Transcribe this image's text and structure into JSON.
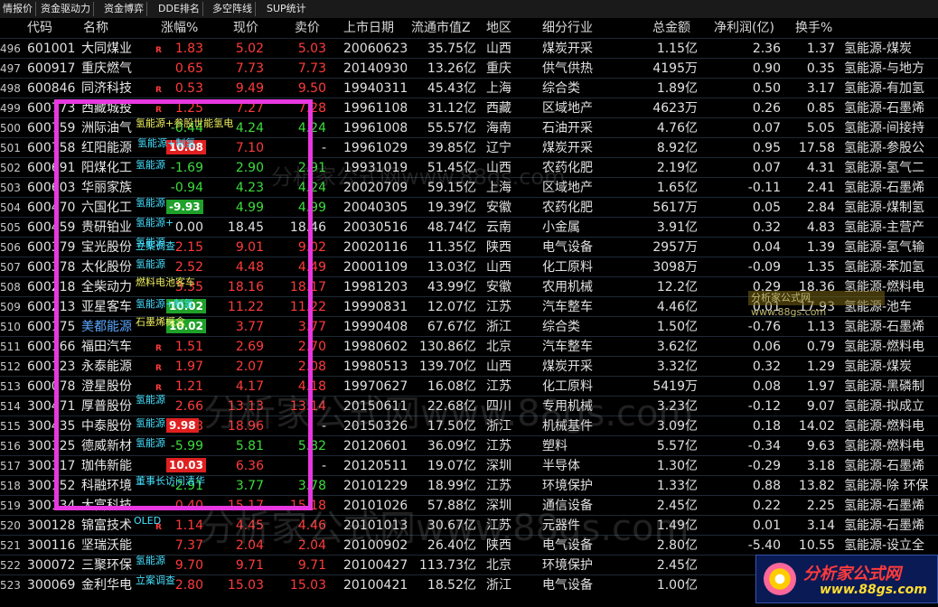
{
  "tabs": [
    "情报价",
    "资金驱动力",
    "资金博弈",
    "DDE排名",
    "多空阵线",
    "SUP统计"
  ],
  "columns": [
    "代码",
    "名称",
    "涨幅%",
    "现价",
    "卖价",
    "上市日期",
    "流通市值Z",
    "地区",
    "细分行业",
    "总金额",
    "净利润(亿)",
    "换手%"
  ],
  "colors": {
    "up": "#ff3b3b",
    "down": "#3cdc3c",
    "accent": "#e838e0"
  },
  "rows": [
    {
      "no": "496",
      "code": "601001",
      "name": "大同煤业",
      "chg": "1.83",
      "price": "5.02",
      "ask": "5.03",
      "date": "20060623",
      "mcap": "35.75亿",
      "region": "山西",
      "industry": "煤炭开采",
      "amount": "1.15亿",
      "profit": "2.36",
      "turnover": "1.37",
      "concept": "氢能源-煤炭",
      "dir": "up",
      "r": true
    },
    {
      "no": "497",
      "code": "600917",
      "name": "重庆燃气",
      "chg": "0.65",
      "price": "7.73",
      "ask": "7.73",
      "date": "20140930",
      "mcap": "13.26亿",
      "region": "重庆",
      "industry": "供气供热",
      "amount": "4195万",
      "profit": "0.90",
      "turnover": "0.35",
      "concept": "氢能源-与地方",
      "dir": "up",
      "r": false
    },
    {
      "no": "498",
      "code": "600846",
      "name": "同济科技",
      "chg": "0.53",
      "price": "9.49",
      "ask": "9.50",
      "date": "19940311",
      "mcap": "45.43亿",
      "region": "上海",
      "industry": "综合类",
      "amount": "1.89亿",
      "profit": "0.50",
      "turnover": "3.17",
      "concept": "氢能源-有加氢",
      "dir": "up",
      "r": true
    },
    {
      "no": "499",
      "code": "600773",
      "name": "西藏城投",
      "chg": "1.25",
      "price": "7.27",
      "ask": "7.28",
      "date": "19961108",
      "mcap": "31.12亿",
      "region": "西藏",
      "industry": "区域地产",
      "amount": "4623万",
      "profit": "0.26",
      "turnover": "0.85",
      "concept": "氢能源-石墨烯",
      "dir": "up",
      "r": true
    },
    {
      "no": "500",
      "code": "600759",
      "name": "洲际油气",
      "chg": "-0.44",
      "price": "4.24",
      "ask": "4.24",
      "date": "19961008",
      "mcap": "55.57亿",
      "region": "海南",
      "industry": "石油开采",
      "amount": "4.76亿",
      "profit": "0.07",
      "turnover": "5.05",
      "concept": "氢能源-间接持",
      "dir": "down",
      "r": false
    },
    {
      "no": "501",
      "code": "600758",
      "name": "红阳能源",
      "chg": "10.08",
      "price": "7.10",
      "ask": "-",
      "date": "19961029",
      "mcap": "39.85亿",
      "region": "辽宁",
      "industry": "煤炭开采",
      "amount": "8.92亿",
      "profit": "0.95",
      "turnover": "17.58",
      "concept": "氢能源-参股公",
      "dir": "up",
      "r": false
    },
    {
      "no": "502",
      "code": "600691",
      "name": "阳煤化工",
      "chg": "-1.69",
      "price": "2.90",
      "ask": "2.91",
      "date": "19931019",
      "mcap": "51.45亿",
      "region": "山西",
      "industry": "农药化肥",
      "amount": "2.19亿",
      "profit": "0.07",
      "turnover": "4.31",
      "concept": "氢能源-氢气二",
      "dir": "down",
      "r": false
    },
    {
      "no": "503",
      "code": "600603",
      "name": "华丽家族",
      "chg": "-0.94",
      "price": "4.23",
      "ask": "4.24",
      "date": "20020709",
      "mcap": "59.15亿",
      "region": "上海",
      "industry": "区域地产",
      "amount": "1.65亿",
      "profit": "-0.11",
      "turnover": "2.41",
      "concept": "氢能源-石墨烯",
      "dir": "down",
      "r": false
    },
    {
      "no": "504",
      "code": "600470",
      "name": "六国化工",
      "chg": "-9.93",
      "price": "4.99",
      "ask": "4.99",
      "date": "20040305",
      "mcap": "19.39亿",
      "region": "安徽",
      "industry": "农药化肥",
      "amount": "5617万",
      "profit": "0.05",
      "turnover": "2.84",
      "concept": "氢能源-煤制氢",
      "dir": "down",
      "r": false
    },
    {
      "no": "505",
      "code": "600459",
      "name": "贵研铂业",
      "chg": "0.00",
      "price": "18.45",
      "ask": "18.46",
      "date": "20030516",
      "mcap": "48.74亿",
      "region": "云南",
      "industry": "小金属",
      "amount": "3.91亿",
      "profit": "0.32",
      "turnover": "4.83",
      "concept": "氢能源-主营产",
      "dir": "flat",
      "r": false
    },
    {
      "no": "506",
      "code": "600379",
      "name": "宝光股份",
      "chg": "2.15",
      "price": "9.01",
      "ask": "9.02",
      "date": "20020116",
      "mcap": "11.35亿",
      "region": "陕西",
      "industry": "电气设备",
      "amount": "2957万",
      "profit": "0.04",
      "turnover": "1.39",
      "concept": "氢能源-氢气输",
      "dir": "up",
      "r": false
    },
    {
      "no": "507",
      "code": "600378",
      "name": "太化股份",
      "chg": "2.52",
      "price": "4.48",
      "ask": "4.49",
      "date": "20001109",
      "mcap": "13.03亿",
      "region": "山西",
      "industry": "化工原料",
      "amount": "3098万",
      "profit": "-0.09",
      "turnover": "1.35",
      "concept": "氢能源-苯加氢",
      "dir": "up",
      "r": false
    },
    {
      "no": "508",
      "code": "600218",
      "name": "全柴动力",
      "chg": "3.35",
      "price": "18.16",
      "ask": "18.17",
      "date": "19981203",
      "mcap": "43.99亿",
      "region": "安徽",
      "industry": "农用机械",
      "amount": "12.2亿",
      "profit": "0.29",
      "turnover": "18.36",
      "concept": "氢能源-燃料电",
      "dir": "up",
      "r": false
    },
    {
      "no": "509",
      "code": "600213",
      "name": "亚星客车",
      "chg": "10.02",
      "price": "11.22",
      "ask": "11.22",
      "date": "19990831",
      "mcap": "12.07亿",
      "region": "江苏",
      "industry": "汽车整车",
      "amount": "4.46亿",
      "profit": "0.01",
      "turnover": "17.93",
      "concept": "氢能源-池车",
      "dir": "up",
      "r": false
    },
    {
      "no": "510",
      "code": "600175",
      "name": "美都能源",
      "chg": "10.02",
      "price": "3.77",
      "ask": "3.77",
      "date": "19990408",
      "mcap": "67.67亿",
      "region": "浙江",
      "industry": "综合类",
      "amount": "1.50亿",
      "profit": "-0.76",
      "turnover": "1.13",
      "concept": "氢能源-石墨烯",
      "dir": "up",
      "r": false
    },
    {
      "no": "511",
      "code": "600166",
      "name": "福田汽车",
      "chg": "1.51",
      "price": "2.69",
      "ask": "2.70",
      "date": "19980602",
      "mcap": "130.86亿",
      "region": "北京",
      "industry": "汽车整车",
      "amount": "3.62亿",
      "profit": "0.06",
      "turnover": "0.79",
      "concept": "氢能源-燃料电",
      "dir": "up",
      "r": true
    },
    {
      "no": "512",
      "code": "600123",
      "name": "永泰能源",
      "chg": "1.97",
      "price": "2.07",
      "ask": "2.08",
      "date": "19980513",
      "mcap": "139.70亿",
      "region": "山西",
      "industry": "煤炭开采",
      "amount": "3.32亿",
      "profit": "0.32",
      "turnover": "1.29",
      "concept": "氢能源-煤炭",
      "dir": "up",
      "r": true
    },
    {
      "no": "513",
      "code": "600078",
      "name": "澄星股份",
      "chg": "1.21",
      "price": "4.17",
      "ask": "4.18",
      "date": "19970627",
      "mcap": "16.08亿",
      "region": "江苏",
      "industry": "化工原料",
      "amount": "5419万",
      "profit": "0.08",
      "turnover": "1.97",
      "concept": "氢能源-黑磷制",
      "dir": "up",
      "r": true
    },
    {
      "no": "514",
      "code": "300471",
      "name": "厚普股份",
      "chg": "2.66",
      "price": "13.13",
      "ask": "13.14",
      "date": "20150611",
      "mcap": "22.68亿",
      "region": "四川",
      "industry": "专用机械",
      "amount": "3.23亿",
      "profit": "-0.12",
      "turnover": "9.07",
      "concept": "氢能源-拟成立",
      "dir": "up",
      "r": false
    },
    {
      "no": "515",
      "code": "300435",
      "name": "中泰股份",
      "chg": "9.98",
      "price": "18.96",
      "ask": "-",
      "date": "20150326",
      "mcap": "17.50亿",
      "region": "浙江",
      "industry": "机械基件",
      "amount": "3.09亿",
      "profit": "0.18",
      "turnover": "14.02",
      "concept": "氢能源-燃料电",
      "dir": "up",
      "r": false
    },
    {
      "no": "516",
      "code": "300325",
      "name": "德威新材",
      "chg": "-5.99",
      "price": "5.81",
      "ask": "5.82",
      "date": "20120601",
      "mcap": "36.09亿",
      "region": "江苏",
      "industry": "塑料",
      "amount": "5.57亿",
      "profit": "-0.34",
      "turnover": "9.63",
      "concept": "氢能源-燃料电",
      "dir": "down",
      "r": false
    },
    {
      "no": "517",
      "code": "300317",
      "name": "珈伟新能",
      "chg": "10.03",
      "price": "6.36",
      "ask": "-",
      "date": "20120511",
      "mcap": "19.07亿",
      "region": "深圳",
      "industry": "半导体",
      "amount": "1.30亿",
      "profit": "-0.29",
      "turnover": "3.18",
      "concept": "氢能源-石墨烯",
      "dir": "up",
      "r": false
    },
    {
      "no": "518",
      "code": "300152",
      "name": "科融环境",
      "chg": "-2.91",
      "price": "3.77",
      "ask": "3.78",
      "date": "20101229",
      "mcap": "18.99亿",
      "region": "江苏",
      "industry": "环境保护",
      "amount": "1.33亿",
      "profit": "0.88",
      "turnover": "13.82",
      "concept": "氢能源-除 环保",
      "dir": "down",
      "r": false
    },
    {
      "no": "519",
      "code": "300134",
      "name": "大富科技",
      "chg": "0.40",
      "price": "15.17",
      "ask": "15.18",
      "date": "20101026",
      "mcap": "57.88亿",
      "region": "深圳",
      "industry": "通信设备",
      "amount": "2.45亿",
      "profit": "0.22",
      "turnover": "2.25",
      "concept": "氢能源-石墨烯",
      "dir": "up",
      "r": false
    },
    {
      "no": "520",
      "code": "300128",
      "name": "锦富技术",
      "chg": "1.14",
      "price": "4.45",
      "ask": "4.46",
      "date": "20101013",
      "mcap": "30.67亿",
      "region": "江苏",
      "industry": "元器件",
      "amount": "1.49亿",
      "profit": "0.01",
      "turnover": "3.14",
      "concept": "氢能源-石墨烯",
      "dir": "up",
      "r": true
    },
    {
      "no": "521",
      "code": "300116",
      "name": "坚瑞沃能",
      "chg": "7.37",
      "price": "2.04",
      "ask": "2.04",
      "date": "20100902",
      "mcap": "26.40亿",
      "region": "陕西",
      "industry": "电气设备",
      "amount": "2.80亿",
      "profit": "-5.40",
      "turnover": "10.55",
      "concept": "氢能源-设立全",
      "dir": "up",
      "r": false
    },
    {
      "no": "522",
      "code": "300072",
      "name": "三聚环保",
      "chg": "9.70",
      "price": "9.71",
      "ask": "9.71",
      "date": "20100427",
      "mcap": "113.73亿",
      "region": "北京",
      "industry": "环境保护",
      "amount": "2.45亿",
      "profit": "",
      "turnover": "",
      "concept": "",
      "dir": "up",
      "r": false
    },
    {
      "no": "523",
      "code": "300069",
      "name": "金利华电",
      "chg": "2.80",
      "price": "15.03",
      "ask": "15.03",
      "date": "20100421",
      "mcap": "18.52亿",
      "region": "浙江",
      "industry": "电气设备",
      "amount": "1.00亿",
      "profit": "",
      "turnover": "",
      "concept": "",
      "dir": "up",
      "r": false
    }
  ],
  "tags": [
    {
      "text": "氢能源+参股世能氢电",
      "color": "yellow"
    },
    {
      "text": "氢能源+制氢",
      "color": "cyan"
    },
    {
      "text": "氢能源",
      "color": "cyan"
    },
    {
      "text": "氢能源",
      "color": "cyan"
    },
    {
      "text": "氢能源+",
      "color": "cyan"
    },
    {
      "text": "氢能源",
      "color": "cyan"
    },
    {
      "text": "立案调查",
      "color": "cyan"
    },
    {
      "text": "氢能源",
      "color": "cyan"
    },
    {
      "text": "燃料电池客车",
      "color": "yellow"
    },
    {
      "text": "氢能源+制氢",
      "color": "cyan"
    },
    {
      "text": "石墨烯概念",
      "color": "yellow"
    },
    {
      "text": "氢能源",
      "color": "cyan"
    },
    {
      "text": "氢能源",
      "color": "cyan"
    },
    {
      "text": "氢能源",
      "color": "cyan"
    },
    {
      "text": "董事长访问清华",
      "color": "cyan"
    },
    {
      "text": "OLED",
      "color": "cyan"
    },
    {
      "text": "氢能源",
      "color": "cyan"
    },
    {
      "text": "立案调查",
      "color": "cyan"
    }
  ],
  "watermarks": [
    "分析家公式网www.88gs.com",
    "分析家公式网www.88gs.com",
    "分析家公式网www.88gs.com"
  ],
  "logo": {
    "title": "分析家公式网",
    "url": "www.88gs.com"
  },
  "side_tags": [
    "分析家公式网www.88gs.com"
  ]
}
